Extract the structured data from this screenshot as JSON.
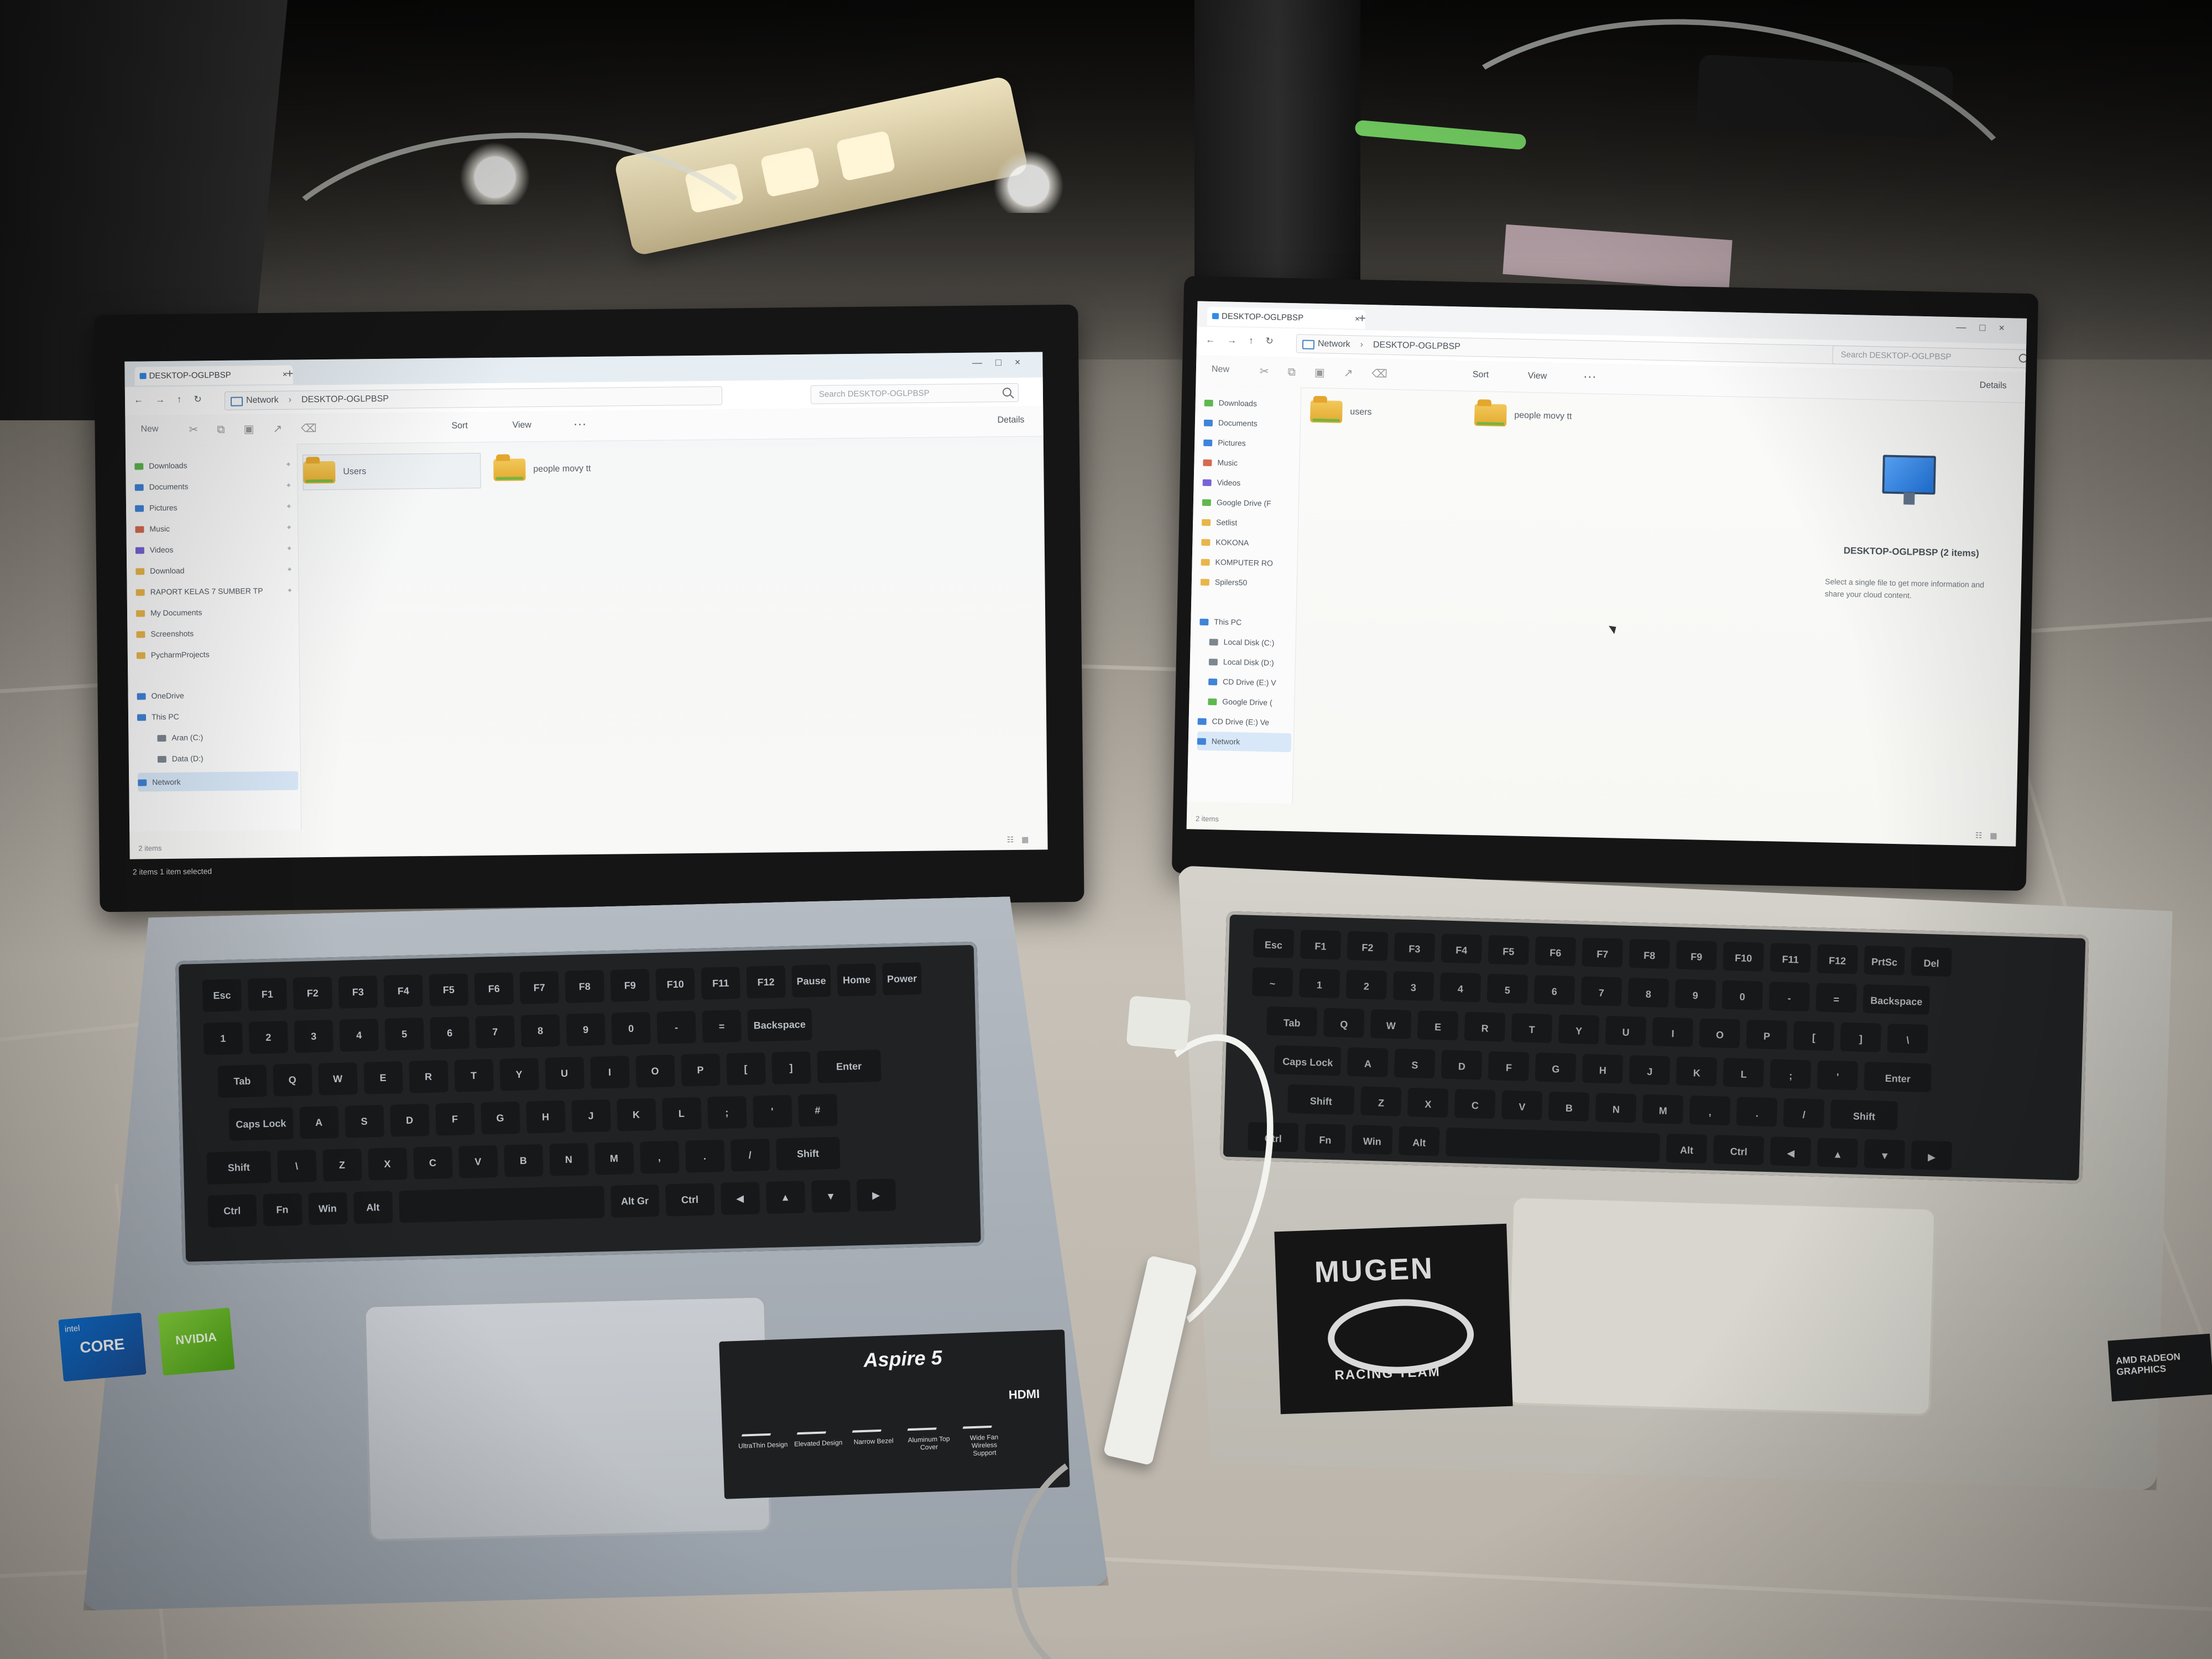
{
  "left_explorer": {
    "tab": "DESKTOP-OGLPBSP",
    "new_tab": "+",
    "breadcrumb": [
      "Network",
      "DESKTOP-OGLPBSP"
    ],
    "search_placeholder": "Search DESKTOP-OGLPBSP",
    "toolbar": {
      "new": "New",
      "sort": "Sort",
      "view": "View",
      "more": "···",
      "details": "Details"
    },
    "sidebar": [
      {
        "label": "Downloads",
        "icon": "download-icon"
      },
      {
        "label": "Documents",
        "icon": "document-icon"
      },
      {
        "label": "Pictures",
        "icon": "picture-icon"
      },
      {
        "label": "Music",
        "icon": "music-icon"
      },
      {
        "label": "Videos",
        "icon": "video-icon"
      },
      {
        "label": "Download",
        "icon": "folder-icon"
      },
      {
        "label": "RAPORT KELAS 7 SUMBER TP",
        "icon": "folder-icon"
      },
      {
        "label": "My Documents",
        "icon": "folder-icon"
      },
      {
        "label": "Screenshots",
        "icon": "folder-icon"
      },
      {
        "label": "PycharmProjects",
        "icon": "folder-icon"
      },
      {
        "label": "OneDrive",
        "icon": "cloud-icon"
      },
      {
        "label": "This PC",
        "icon": "computer-icon"
      },
      {
        "label": "Aran (C:)",
        "icon": "drive-icon"
      },
      {
        "label": "Data (D:)",
        "icon": "drive-icon"
      },
      {
        "label": "Network",
        "icon": "network-icon"
      }
    ],
    "folders": [
      "Users",
      "people movy tt"
    ],
    "status_window": "2 items",
    "status_screen": "2 items    1 item selected"
  },
  "right_explorer": {
    "tab": "DESKTOP-OGLPBSP",
    "new_tab": "+",
    "breadcrumb": [
      "Network",
      "DESKTOP-OGLPBSP"
    ],
    "search_placeholder": "Search DESKTOP-OGLPBSP",
    "toolbar": {
      "new": "New",
      "sort": "Sort",
      "view": "View",
      "more": "···",
      "details": "Details"
    },
    "sidebar": [
      {
        "label": "Downloads",
        "icon": "download-icon"
      },
      {
        "label": "Documents",
        "icon": "document-icon"
      },
      {
        "label": "Pictures",
        "icon": "picture-icon"
      },
      {
        "label": "Music",
        "icon": "music-icon"
      },
      {
        "label": "Videos",
        "icon": "video-icon"
      },
      {
        "label": "Google Drive (F",
        "icon": "drive-icon"
      },
      {
        "label": "Setlist",
        "icon": "folder-icon"
      },
      {
        "label": "KOKONA",
        "icon": "folder-icon"
      },
      {
        "label": "KOMPUTER RO",
        "icon": "folder-icon"
      },
      {
        "label": "Spilers50",
        "icon": "folder-icon"
      },
      {
        "label": "This PC",
        "icon": "computer-icon"
      },
      {
        "label": "Local Disk (C:)",
        "icon": "drive-icon"
      },
      {
        "label": "Local Disk (D:)",
        "icon": "drive-icon"
      },
      {
        "label": "CD Drive (E:) V",
        "icon": "cd-icon"
      },
      {
        "label": "Google Drive (",
        "icon": "drive-icon"
      },
      {
        "label": "CD Drive (E:) Ve",
        "icon": "cd-icon"
      },
      {
        "label": "Network",
        "icon": "network-icon"
      }
    ],
    "folders": [
      "users",
      "people movy tt"
    ],
    "details_title": "DESKTOP-OGLPBSP (2 items)",
    "details_info": "Select a single file to get more information and share your cloud content.",
    "status": "2 items"
  },
  "left_laptop": {
    "brand": "Aspire 5",
    "features": [
      "UltraThin Design",
      "Elevated Design",
      "Narrow Bezel",
      "Aluminum Top Cover",
      "Wide Fan Wireless Support"
    ],
    "ports": "HDMI",
    "intel_badge": "CORE",
    "nvidia_badge": "NVIDIA",
    "keys_row1": [
      "Esc",
      "F1",
      "F2",
      "F3",
      "F4",
      "F5",
      "F6",
      "F7",
      "F8",
      "F9",
      "F10",
      "F11",
      "F12",
      "Pause",
      "Home",
      "Power"
    ],
    "keys_row2": [
      "1",
      "2",
      "3",
      "4",
      "5",
      "6",
      "7",
      "8",
      "9",
      "0",
      "-",
      "=",
      "Backspace"
    ],
    "keys_row3": [
      "Tab",
      "Q",
      "W",
      "E",
      "R",
      "T",
      "Y",
      "U",
      "I",
      "O",
      "P",
      "[",
      "]",
      "Enter"
    ],
    "keys_row4": [
      "Caps Lock",
      "A",
      "S",
      "D",
      "F",
      "G",
      "H",
      "J",
      "K",
      "L",
      ";",
      "'",
      "#"
    ],
    "keys_row5": [
      "Shift",
      "\\",
      "Z",
      "X",
      "C",
      "V",
      "B",
      "N",
      "M",
      ",",
      ".",
      "/",
      "Shift"
    ],
    "keys_row6": [
      "Ctrl",
      "Fn",
      "Win",
      "Alt",
      "",
      "Alt Gr",
      "Ctrl",
      "◀",
      "▲",
      "▼",
      "▶"
    ]
  },
  "right_laptop": {
    "sticker_title": "MUGEN",
    "sticker_subtitle": "RACING TEAM",
    "amd_badge": "AMD RADEON GRAPHICS",
    "keys_row1": [
      "Esc",
      "F1",
      "F2",
      "F3",
      "F4",
      "F5",
      "F6",
      "F7",
      "F8",
      "F9",
      "F10",
      "F11",
      "F12",
      "PrtSc",
      "Del"
    ],
    "keys_row2": [
      "~",
      "1",
      "2",
      "3",
      "4",
      "5",
      "6",
      "7",
      "8",
      "9",
      "0",
      "-",
      "=",
      "Backspace"
    ],
    "keys_row3": [
      "Tab",
      "Q",
      "W",
      "E",
      "R",
      "T",
      "Y",
      "U",
      "I",
      "O",
      "P",
      "[",
      "]",
      "\\"
    ],
    "keys_row4": [
      "Caps Lock",
      "A",
      "S",
      "D",
      "F",
      "G",
      "H",
      "J",
      "K",
      "L",
      ";",
      "'",
      "Enter"
    ],
    "keys_row5": [
      "Shift",
      "Z",
      "X",
      "C",
      "V",
      "B",
      "N",
      "M",
      ",",
      ".",
      "/",
      "Shift"
    ],
    "keys_row6": [
      "Ctrl",
      "Fn",
      "Win",
      "Alt",
      "",
      "Alt",
      "Ctrl",
      "◀",
      "▲",
      "▼",
      "▶"
    ]
  }
}
